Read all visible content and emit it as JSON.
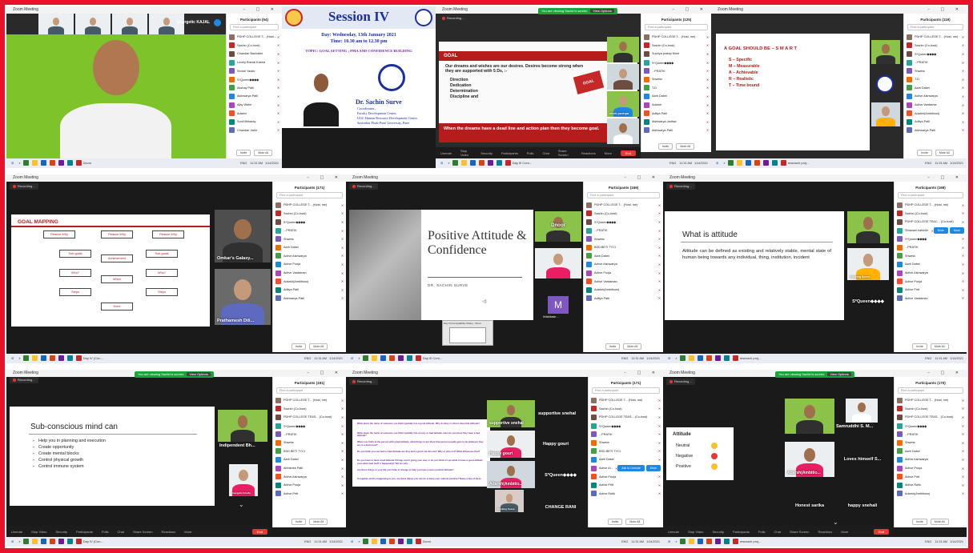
{
  "colors": {
    "frame_border": "#e8102a",
    "zoom_dark": "#1c1c1c",
    "share_green": "#18a53a",
    "slide_red": "#b71c1c",
    "session_blue": "#1a2fa0",
    "topic_purple": "#7a1fb0"
  },
  "common": {
    "window_title": "Zoom Meeting",
    "recording": "Recording...",
    "sharing_banner": "You are viewing Sachin's screen",
    "view_options": "View Options",
    "search_placeholder": "Find a participant",
    "invite": "Invite",
    "mute_all": "Mute All",
    "end": "End",
    "toolbar": [
      "Unmute",
      "Stop Video",
      "Security",
      "Participants",
      "Polls",
      "Chat",
      "Share Screen",
      "Reactions",
      "More"
    ]
  },
  "screens": [
    {
      "participants_title": "Participants (54)",
      "energetic_name": "Energetic KAJAL",
      "participants": [
        "PDHP COLLEGE T... (Host, me)",
        "Sachin (Co-host)",
        "Chandan Bankalbe",
        "Lovely Bheral Karma",
        "Smruti Yadav",
        "S*Queen◆◆◆◆",
        "Akshay Patil",
        "Aishwarya Patil",
        "Ajay Wahe",
        "Adaeni",
        "Sunil Birkaray",
        "Chandan Vahir"
      ]
    },
    {
      "session_title": "Session IV",
      "day_line": "Day: Wednesday, 13th January 2021",
      "time_line": "Time: 10.30 am to 12.30 pm",
      "topic": "TOPIC: GOAL SETTING ; PMA AND CONFIDENCE BUILDING",
      "speaker": "Dr. Sachin Surve",
      "speaker_role": "Coordinator,",
      "speaker_org": [
        "Faculty Development Center,",
        "UGC Human Resource Development Centre,",
        "Savitribai Phule Pune University, Pune"
      ]
    },
    {
      "slide_heading": "GOAL",
      "slide_intro": "Our dreams and wishes are our desires. Desires become strong when they are supported with 5 Ds, :-",
      "slide_bullets": [
        "Direction",
        "Dedication",
        "Determination",
        "Discipline and"
      ],
      "slide_footer": "When the dreams have a dead line and action plan then they become goal.",
      "goal_sign": "GOAL",
      "participants_title": "Participants (125)",
      "participants": [
        "PDHP COLLEGE T... (Host, me)",
        "Sachin (Co-host)",
        "Supriya pratap More",
        "S*Queen◆◆◆◆",
        "...PRATIK",
        "Shweta",
        "T.D.",
        "Aarti Dabei",
        "Adarsh",
        "Aditya Patil",
        "Aishwarya Jadhav",
        "Aishwarya Patil"
      ],
      "tile_name": "vivek pushpa"
    },
    {
      "smart_title": "A GOAL SHOULD BE – S M A R T",
      "smart_items": [
        "S – Specific",
        "M – Measurable",
        "A – Achievable",
        "R – Realistic",
        "T – Time bound"
      ],
      "participants_title": "Participants (119)",
      "participants": [
        "PDHP COLLEGE T... (Host, me)",
        "Sachin (Co-host)",
        "S*Queen◆◆◆◆",
        "...PRATIK",
        "Shweta",
        "T.D.",
        "Aarti Dabei",
        "Active Aishwarya",
        "Active Vardamar",
        "Adarsh(Ambitious)",
        "Aditya Patil",
        "Aishwarya Patil"
      ]
    },
    {
      "slide_heading": "GOAL MAPPING",
      "map_boxes": [
        "Reason Why",
        "Reason Why",
        "Reason Why",
        "Sub-goals",
        "Achievement",
        "Sub-goals",
        "Who?",
        "When",
        "Who?",
        "Steps",
        "Steps",
        "Done"
      ],
      "tile_names": [
        "Omkar's Galaxy...",
        "Prathamesh Dili..."
      ],
      "participants_title": "Participants (171)",
      "participants": [
        "PDHP COLLEGE T... (Host, me)",
        "Sachin (Co-host)",
        "S*Queen◆◆◆◆",
        "...PRATIK",
        "Shweta",
        "Aarti Dabei",
        "Active Aishwarya",
        "Active Pooja",
        "Active Vardaman",
        "Adarsh(Ambitious)",
        "Aditya Patil",
        "Aishwarya Patil"
      ]
    },
    {
      "title_slide": "Positive Attitude & Confidence",
      "author": "DR. SACHIN SURVE",
      "tile_names": [
        "Dnoor",
        "M",
        "Hrishikesh ..."
      ],
      "compat_label": "Day III [Compatibility Mode] - Word",
      "participants_title": "Participants (169)",
      "participants": [
        "PDHP COLLEGE T... (Host, me)",
        "Sachin (Co-host)",
        "S*Queen◆◆◆◆",
        "...PRATIK",
        "Shweta",
        "BSD BETI TYCI",
        "Aarti Dabei",
        "Active Aishwarya",
        "Active Pooja",
        "Active Vardaman",
        "Adarsh(Ambitious)",
        "Aditya Patil"
      ]
    },
    {
      "slide_heading": "What is attitude",
      "slide_body": "Attitude can be defined as existing and relatively stable, mental state of human being towards any individual, thing, institution, incident",
      "tile_names": [
        "Cooking Scene...",
        "S*Queen◆◆◆◆"
      ],
      "participants_title": "Participants (169)",
      "participants": [
        "PDHP COLLEGE T... (Host, me)",
        "Sachin (Co-host)",
        "PDHP COLLEGE TEAC... (Co-host)",
        "Shravani karkhile",
        "S*Queen◆◆◆◆",
        "...PRATIK",
        "Shweta",
        "Aarti Dabei",
        "Active Aishwarya",
        "Active Pooja",
        "Active Pritt",
        "Active Vardaman"
      ],
      "mute_label": "Mute",
      "more_label": "More"
    },
    {
      "slide_heading": "Sub-conscious mind can",
      "slide_bullets": [
        "Help you in planning and execution",
        "Create opportunity",
        "Create mental blocks",
        "Control physical growth",
        "Control immune system"
      ],
      "tile_names": [
        "Indipendent Bh...",
        "Energetic KAJAL"
      ],
      "participants_title": "Participants (191)",
      "participants": [
        "PDHP COLLEGE T... (Host, me)",
        "Sachin (Co-host)",
        "PDHP COLLEGE TEAS... (Co-host)",
        "S*Queen◆◆◆◆",
        "...PRATIK",
        "Shweta",
        "BSD BETI TYCI",
        "Aarti Dabei",
        "Abhishek Patil",
        "Active Aishwarya",
        "Active Pooja",
        "Active Pritt"
      ]
    },
    {
      "questions": [
        "Write down the name of someone you think typically has a good attitude. Why do they or others have that attitude?",
        "Write down the name of someone you think typically has a lousy or bad attitude. How do you know they have a bad attitude?",
        "When you think of the person with a bad attitude, what things in are there that person usually gets to do whatever they are in a bad mood?",
        "Do you think you can learn a bad attitude are they and a good role the can? Why or why not? What influences that?",
        "Do you have to have a bad attitude if things aren't going your way or do you think it's possible to have a good attitude even when bad stuff is happening? Tell me why.",
        "Are there things in your life you'd like to change to help you have a more positive attitude?",
        "If negative stuff is happening to you, are there things you can do to keep your outlook positive? Name a few of them."
      ],
      "tile_names": [
        "supportive snehal",
        "Happy gouri",
        "Adarsh(Ambitio...",
        "S*Queen◆◆◆◆",
        "CHANGE RANI",
        "Cooking Scene"
      ],
      "participants_title": "Participants (171)",
      "participants": [
        "PDHP COLLEGE T... (Host, me)",
        "Sachin (Co-host)",
        "PDHP COLLEGE TEAS... (Co-host)",
        "S*Queen◆◆◆◆",
        "...PRATIK",
        "Shweta",
        "BSD BETI TYCI",
        "Aarti Dabei",
        "Active Aishwarya",
        "Active Pooja",
        "Active Pritt",
        "Active Rutik"
      ],
      "ask_unmute": "Ask to Unmute",
      "more_label": "More"
    },
    {
      "box_title": "Attitude",
      "box_items": [
        "Neutral",
        "Negative",
        "Positive"
      ],
      "tile_names": [
        "Samruddhi S. M...",
        "Adarsh(Ambitio...",
        "Loves himself S...",
        "Honest sarika",
        "happy snehali"
      ],
      "participants_title": "Participants (170)",
      "participants": [
        "PDHP COLLEGE T... (Host, me)",
        "Sachin (Co-host)",
        "PDHP COLLEGE TEAS... (Co-host)",
        "S*Queen◆◆◆◆",
        "...PRATIK",
        "Shweta",
        "Aarti Dabei",
        "Active Aishwarya",
        "Active Pooja",
        "Active Pritt",
        "Active Rutik",
        "Adarsh(Ambitious)"
      ]
    }
  ],
  "taskbar": {
    "search": "Type here to search",
    "apps": [
      "Day IV (Con...",
      "Zoom",
      "Day III Com...",
      "research proj..."
    ],
    "time": "11:31 AM",
    "date": "1/14/2021",
    "lang": "ENG"
  }
}
